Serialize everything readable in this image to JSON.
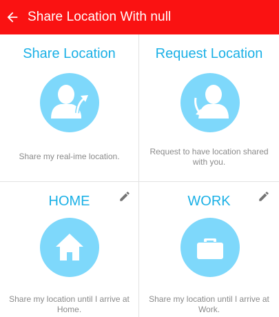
{
  "appbar": {
    "title": "Share Location With null",
    "back_icon": "arrow-back-icon",
    "color": "#fa1212"
  },
  "cards": {
    "share": {
      "title": "Share Location",
      "description": "Share my real-ime location.",
      "icon": "person-upload-icon"
    },
    "request": {
      "title": "Request Location",
      "description": "Request to have location shared with you.",
      "icon": "person-download-icon"
    },
    "home": {
      "title": "HOME",
      "description": "Share my location until I arrive at Home.",
      "icon": "home-icon",
      "edit_icon": "pencil-icon"
    },
    "work": {
      "title": "WORK",
      "description": "Share my location until I arrive at Work.",
      "icon": "briefcase-icon",
      "edit_icon": "pencil-icon"
    }
  },
  "colors": {
    "accent": "#1ab0e6",
    "circle": "#7ed8fb",
    "text_secondary": "#8a8a8a"
  }
}
